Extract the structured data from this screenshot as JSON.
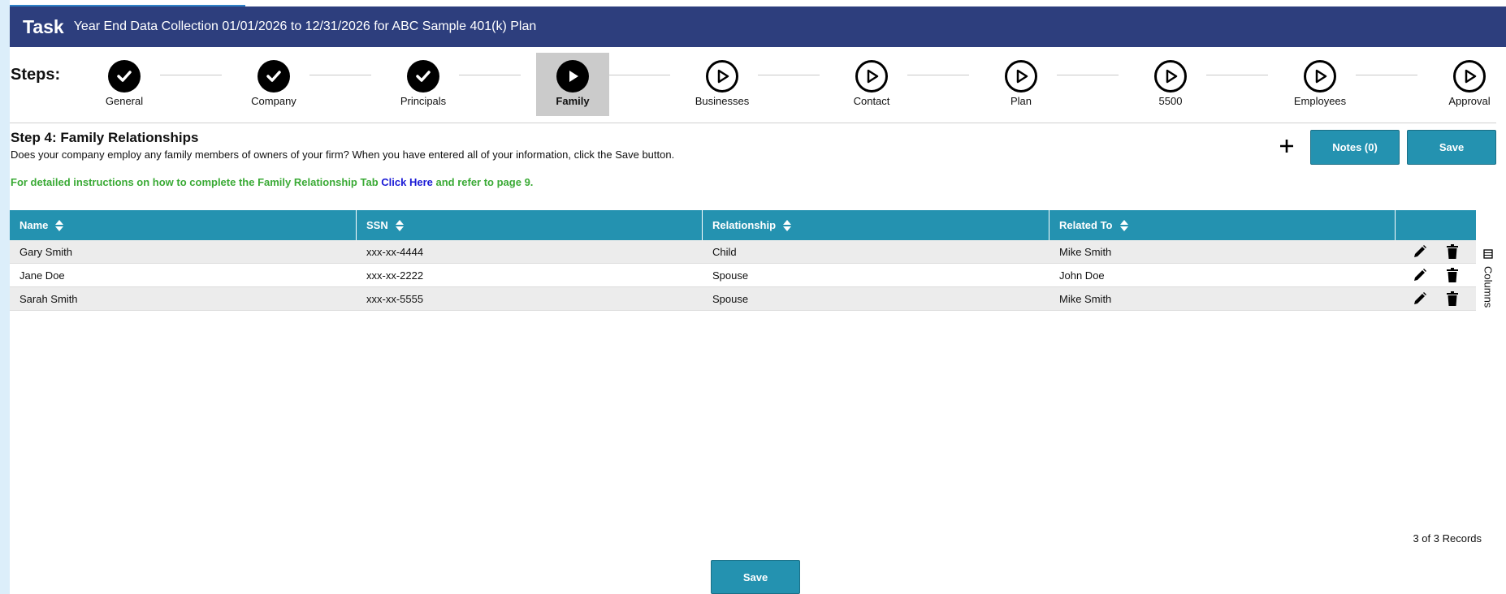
{
  "header": {
    "task_label": "Task",
    "subtitle": "Year End Data Collection 01/01/2026 to 12/31/2026 for ABC Sample 401(k) Plan"
  },
  "steps": {
    "label": "Steps:",
    "items": [
      {
        "label": "General",
        "status": "done"
      },
      {
        "label": "Company",
        "status": "done"
      },
      {
        "label": "Principals",
        "status": "done"
      },
      {
        "label": "Family",
        "status": "current"
      },
      {
        "label": "Businesses",
        "status": "todo"
      },
      {
        "label": "Contact",
        "status": "todo"
      },
      {
        "label": "Plan",
        "status": "todo"
      },
      {
        "label": "5500",
        "status": "todo"
      },
      {
        "label": "Employees",
        "status": "todo"
      },
      {
        "label": "Approval",
        "status": "todo"
      }
    ]
  },
  "section": {
    "title": "Step 4: Family Relationships",
    "description": "Does your company employ any family members of owners of your firm? When you have entered all of your information, click the Save button.",
    "instruction_prefix": "For detailed instructions on how to complete the Family Relationship Tab",
    "instruction_link": "Click Here",
    "instruction_suffix": "and refer to page 9."
  },
  "toolbar": {
    "add_icon": "plus-icon",
    "notes_label": "Notes (0)",
    "save_label": "Save"
  },
  "table": {
    "columns": [
      "Name",
      "SSN",
      "Relationship",
      "Related To"
    ],
    "rows": [
      {
        "name": "Gary Smith",
        "ssn": "xxx-xx-4444",
        "relationship": "Child",
        "related_to": "Mike Smith"
      },
      {
        "name": "Jane Doe",
        "ssn": "xxx-xx-2222",
        "relationship": "Spouse",
        "related_to": "John Doe"
      },
      {
        "name": "Sarah Smith",
        "ssn": "xxx-xx-5555",
        "relationship": "Spouse",
        "related_to": "Mike Smith"
      }
    ],
    "columns_tab_label": "Columns",
    "records_text": "3 of 3 Records"
  },
  "footer": {
    "save_label": "Save"
  },
  "colors": {
    "header_bg": "#2d3e7d",
    "accent": "#2492b0",
    "instruction_green": "#3aaa35",
    "link_blue": "#1a1ad6"
  }
}
